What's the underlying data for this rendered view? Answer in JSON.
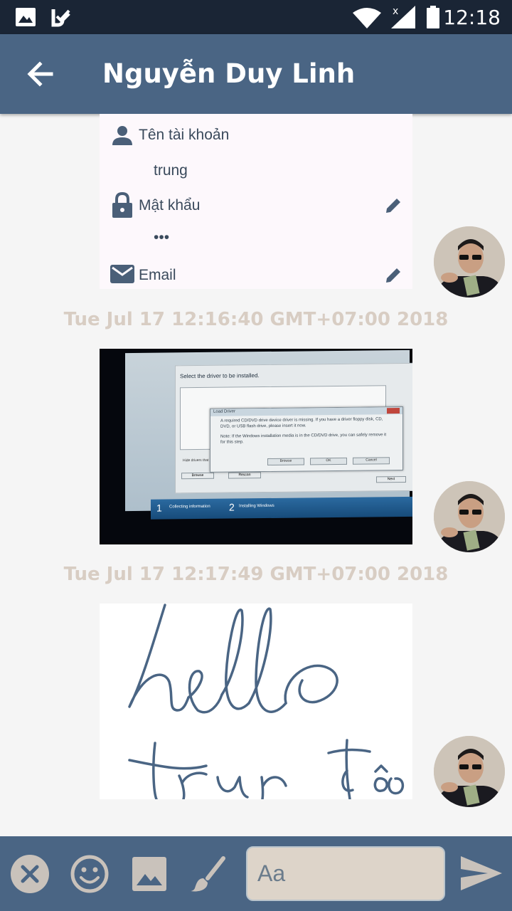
{
  "status_bar": {
    "time": "12:18",
    "icons": [
      "gallery-icon",
      "check-notification-icon",
      "wifi-icon",
      "signal-icon",
      "battery-icon"
    ]
  },
  "app_bar": {
    "title": "Nguyễn Duy Linh",
    "back_icon": "arrow-back-icon"
  },
  "messages": [
    {
      "type": "image",
      "content": "settings-screenshot",
      "rows": [
        {
          "icon": "person-icon",
          "label": "Tên tài khoản",
          "value": "trung",
          "editable": false
        },
        {
          "icon": "lock-icon",
          "label": "Mật khẩu",
          "value": "•••",
          "editable": true
        },
        {
          "icon": "mail-icon",
          "label": "Email",
          "editable": true
        }
      ]
    },
    {
      "type": "image",
      "content": "monitor-photo",
      "timestamp": "Tue Jul 17 12:16:40 GMT+07:00 2018",
      "screen": {
        "title": "Select the driver to be installed.",
        "dialog_title": "Load Driver",
        "dialog_lines": [
          "A required CD/DVD drive device driver is missing. If you have a driver floppy disk, CD,",
          "DVD, or USB flash drive, please insert it now.",
          "Note: If the Windows installation media is in the CD/DVD drive, you can safely remove it",
          "for this step."
        ],
        "buttons": [
          "Browse",
          "OK",
          "Cancel"
        ],
        "checkbox_label": "Hide drivers that are not compatible with hardware on this computer.",
        "outer_buttons": [
          "Browse",
          "Rescan",
          "Next"
        ],
        "steps": [
          {
            "number": "1",
            "label": "Collecting information"
          },
          {
            "number": "2",
            "label": "Installing Windows"
          }
        ]
      }
    },
    {
      "type": "image",
      "content": "handwriting-drawing",
      "timestamp": "Tue Jul 17 12:17:49 GMT+07:00 2018",
      "handwriting": "hello trung đồ"
    }
  ],
  "composer": {
    "placeholder": "Aa",
    "tools": [
      "close-icon",
      "emoji-icon",
      "image-icon",
      "brush-icon"
    ],
    "send_icon": "send-icon"
  },
  "colors": {
    "status_bar": "#1a2535",
    "app_bar": "#4a6584",
    "background": "#f5f5f5",
    "timestamp": "#d8cdc3",
    "ink": "#4a6584",
    "input_bg": "#ddd4c9"
  }
}
